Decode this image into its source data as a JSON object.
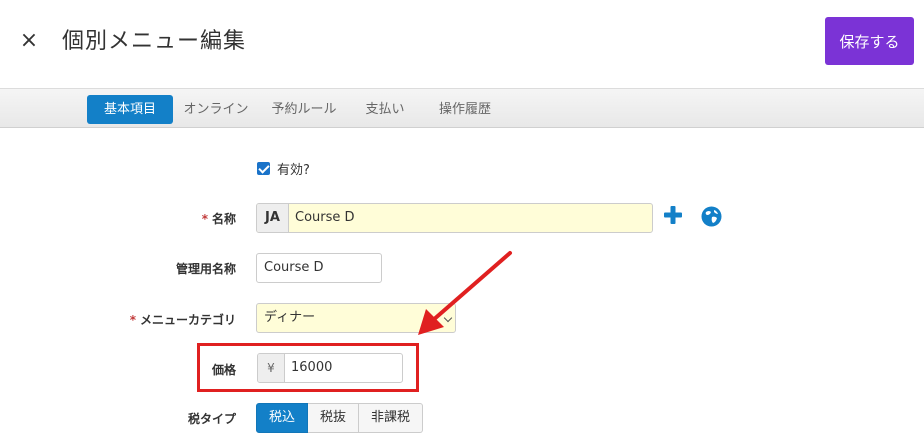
{
  "header": {
    "title": "個別メニュー編集",
    "close_glyph": "×",
    "save_label": "保存する"
  },
  "tabs": [
    {
      "label": "基本項目",
      "active": true
    },
    {
      "label": "オンライン",
      "active": false
    },
    {
      "label": "予約ルール",
      "active": false
    },
    {
      "label": "支払い",
      "active": false
    },
    {
      "label": "操作履歴",
      "active": false
    }
  ],
  "form": {
    "enabled": {
      "label": "有効?",
      "checked": true
    },
    "name": {
      "required_mark": "*",
      "label": "名称",
      "lang_code": "JA",
      "value": "Course D"
    },
    "admin_name": {
      "label": "管理用名称",
      "value": "Course D"
    },
    "menu_category": {
      "required_mark": "*",
      "label": "メニューカテゴリ",
      "value": "ディナー"
    },
    "price": {
      "label": "価格",
      "currency_symbol": "¥",
      "value": "16000"
    },
    "tax_type": {
      "label": "税タイプ",
      "options": [
        {
          "label": "税込",
          "active": true
        },
        {
          "label": "税抜",
          "active": false
        },
        {
          "label": "非課税",
          "active": false
        }
      ]
    }
  },
  "colors": {
    "accent_purple": "#7b33d6",
    "tab_active_blue": "#1380c8",
    "highlight_red": "#e02020",
    "input_yellow": "#fffdd8"
  },
  "icons": {
    "close": "close-icon",
    "add": "plus-icon",
    "globe": "globe-icon",
    "dropdown": "chevron-down-icon"
  }
}
